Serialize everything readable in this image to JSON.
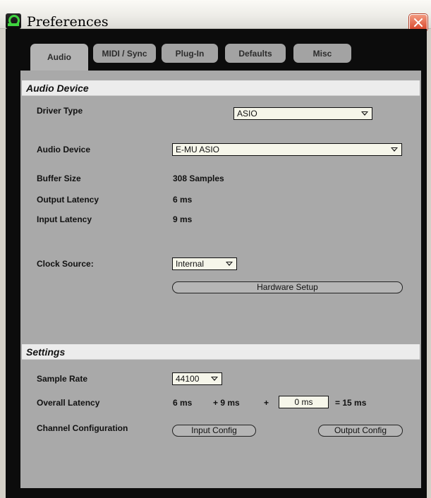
{
  "window": {
    "title": "Preferences"
  },
  "tabs": [
    {
      "label": "Audio",
      "active": true
    },
    {
      "label": "MIDI / Sync",
      "active": false
    },
    {
      "label": "Plug-In",
      "active": false
    },
    {
      "label": "Defaults",
      "active": false
    },
    {
      "label": "Misc",
      "active": false
    }
  ],
  "audio_device": {
    "header": "Audio Device",
    "driver_type_label": "Driver Type",
    "driver_type_value": "ASIO",
    "audio_device_label": "Audio Device",
    "audio_device_value": "E-MU ASIO",
    "buffer_size_label": "Buffer Size",
    "buffer_size_value": "308 Samples",
    "output_latency_label": "Output Latency",
    "output_latency_value": "6 ms",
    "input_latency_label": "Input Latency",
    "input_latency_value": "9 ms",
    "clock_source_label": "Clock Source:",
    "clock_source_value": "Internal",
    "hardware_setup_label": "Hardware Setup"
  },
  "settings": {
    "header": "Settings",
    "sample_rate_label": "Sample Rate",
    "sample_rate_value": "44100",
    "overall_latency_label": "Overall Latency",
    "latency_out": "6 ms",
    "latency_in": "+ 9 ms",
    "latency_plus": "+",
    "latency_extra_value": "0 ms",
    "latency_total": "= 15 ms",
    "channel_config_label": "Channel Configuration",
    "input_config_label": "Input Config",
    "output_config_label": "Output Config"
  },
  "icons": {
    "app": "ableton-live-icon",
    "close": "close-icon",
    "dropdown": "triangle-down-icon"
  },
  "colors": {
    "panel": "#a9a9a9",
    "section_header": "#ececec",
    "background": "#0c0c0c",
    "close_button": "#d8452a"
  }
}
